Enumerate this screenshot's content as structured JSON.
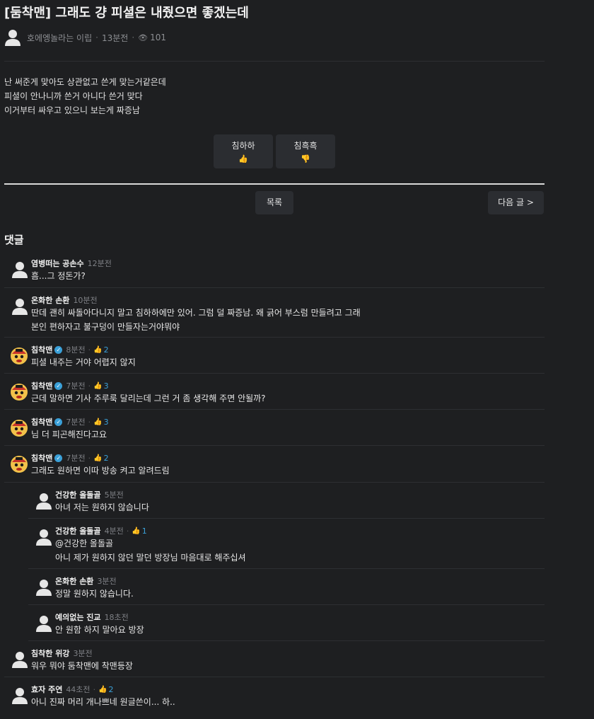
{
  "post": {
    "title": "[둠착맨] 그래도 걍 피셜은 내줬으면 좋겠는데",
    "author": "호에엥놀라는 이립",
    "time": "13분전",
    "views": "101",
    "body": [
      "난 써준게 맞아도 상관없고 쓴게 맞는거같은데",
      "피셜이 안나니까 쓴거 아니다 쓴거 맞다",
      "이거부터 싸우고 있으니 보는게 짜증남"
    ],
    "votes": {
      "up_label": "침하하",
      "up_emoji": "👍",
      "down_label": "침흑흑",
      "down_emoji": "👎"
    },
    "list_button": "목록",
    "next_button": "다음 글 >"
  },
  "comments_title": "댓글",
  "comments": [
    {
      "nick": "염병떠는 공손수",
      "time": "12분전",
      "likes": "",
      "lines": [
        "흠...그 정돈가?"
      ],
      "avatar": "default",
      "verified": false,
      "reply": false
    },
    {
      "nick": "온화한 손환",
      "time": "10분전",
      "likes": "",
      "lines": [
        "딴데 괜히 싸돌아다니지 말고 침하하에만 있어. 그럼 덜 짜증남. 왜 긁어 부스럼 만들려고 그래",
        "본인 편하자고 불구덩이 만들자는거야뭐야"
      ],
      "avatar": "default",
      "verified": false,
      "reply": false
    },
    {
      "nick": "침착맨",
      "time": "8분전",
      "likes": "2",
      "lines": [
        "피셜 내주는 거야 어렵지 않지"
      ],
      "avatar": "chim",
      "verified": true,
      "reply": false
    },
    {
      "nick": "침착맨",
      "time": "7분전",
      "likes": "3",
      "lines": [
        "근데 말하면 기사 주루룩 달리는데 그런 거 좀 생각해 주면 안될까?"
      ],
      "avatar": "chim",
      "verified": true,
      "reply": false
    },
    {
      "nick": "침착맨",
      "time": "7분전",
      "likes": "3",
      "lines": [
        "님 더 피곤해진다고요"
      ],
      "avatar": "chim",
      "verified": true,
      "reply": false
    },
    {
      "nick": "침착맨",
      "time": "7분전",
      "likes": "2",
      "lines": [
        "그래도 원하면 이따 방송 켜고 알려드림"
      ],
      "avatar": "chim",
      "verified": true,
      "reply": false
    },
    {
      "nick": "건강한 올돌골",
      "time": "5분전",
      "likes": "",
      "lines": [
        "아녀 저는 원하지 않습니다"
      ],
      "avatar": "default",
      "verified": false,
      "reply": true
    },
    {
      "nick": "건강한 올돌골",
      "time": "4분전",
      "likes": "1",
      "lines": [
        "@건강한 올돌골",
        "아니 제가 원하지 않던 말던 방장님 마음대로 해주십셔"
      ],
      "avatar": "default",
      "verified": false,
      "reply": true
    },
    {
      "nick": "온화한 손환",
      "time": "3분전",
      "likes": "",
      "lines": [
        "정말 원하지 않습니다."
      ],
      "avatar": "default",
      "verified": false,
      "reply": true
    },
    {
      "nick": "예의없는 진교",
      "time": "18초전",
      "likes": "",
      "lines": [
        "안 원함 하지 말아요 방장"
      ],
      "avatar": "default",
      "verified": false,
      "reply": true
    },
    {
      "nick": "침착한 위강",
      "time": "3분전",
      "likes": "",
      "lines": [
        "워우 뭐야 둠착맨에 착맨등장"
      ],
      "avatar": "default",
      "verified": false,
      "reply": false
    },
    {
      "nick": "효자 주연",
      "time": "44초전",
      "likes": "2",
      "lines": [
        "아니 진짜 머리 개나쁘네 원글쓴이... 하.."
      ],
      "avatar": "default",
      "verified": false,
      "reply": false
    }
  ]
}
